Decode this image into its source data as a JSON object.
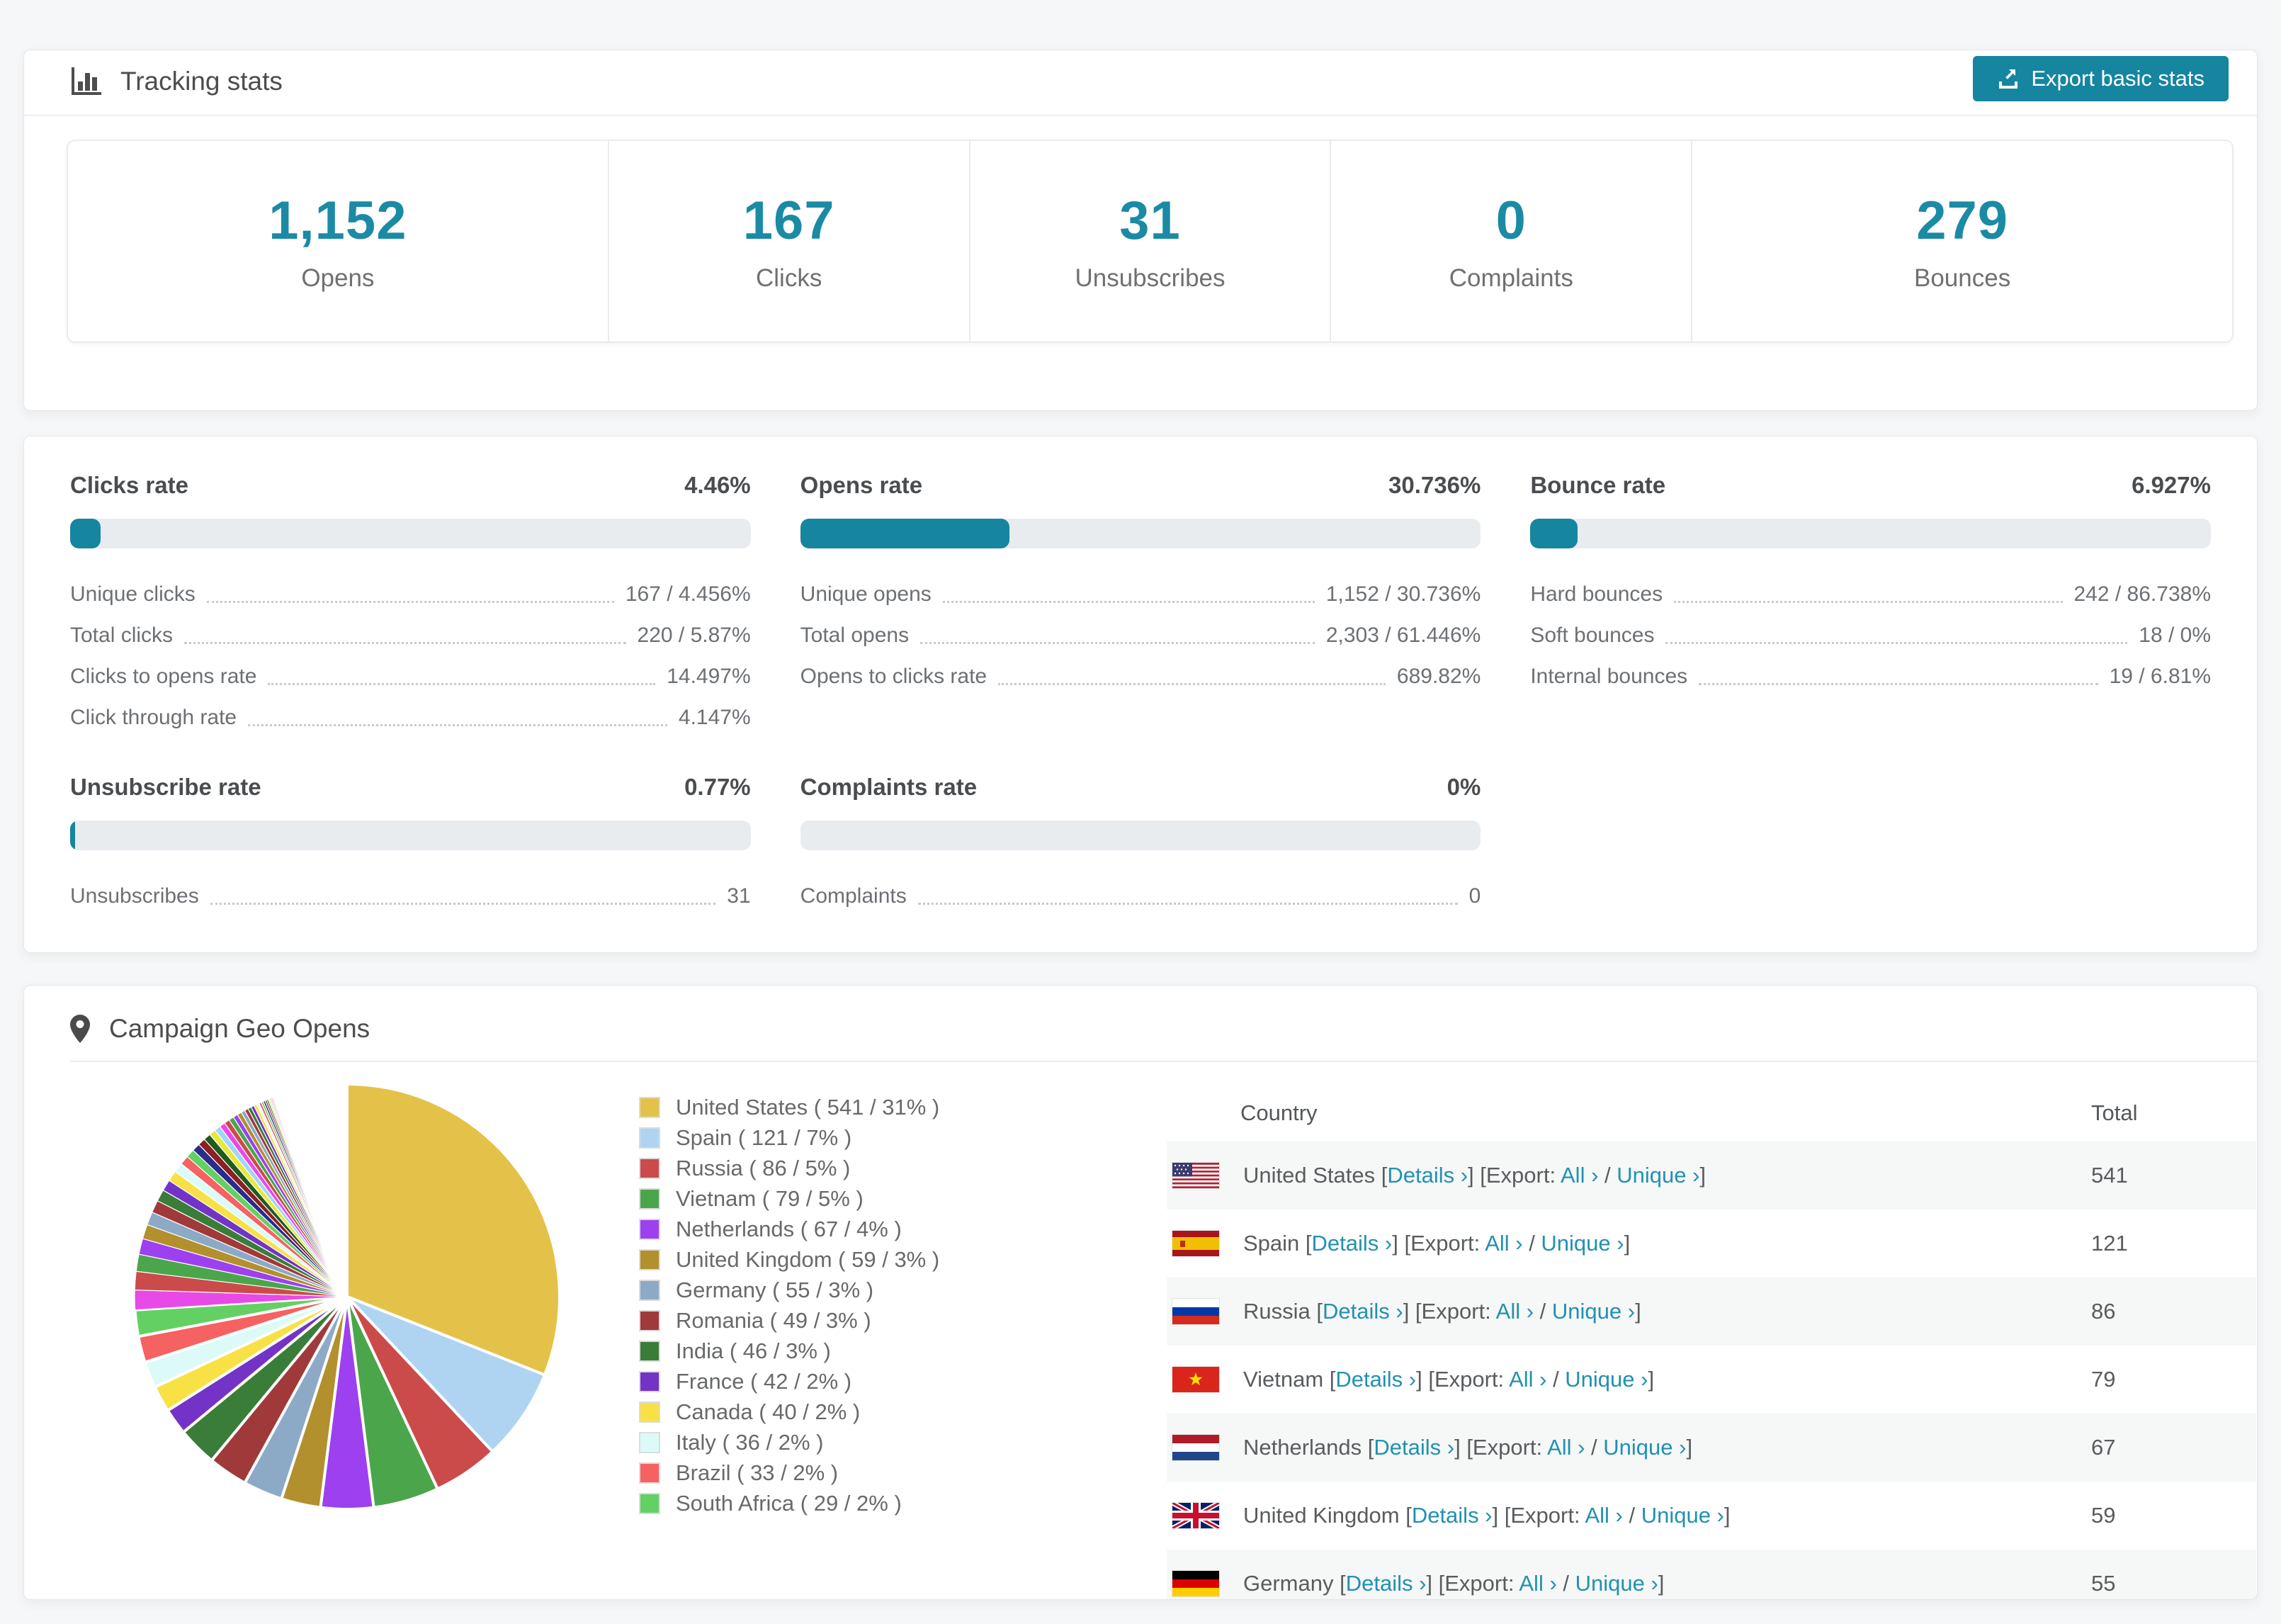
{
  "accent": "#1585a0",
  "tracking": {
    "title": "Tracking stats",
    "export_button": "Export basic stats",
    "stats": [
      {
        "value": "1,152",
        "label": "Opens"
      },
      {
        "value": "167",
        "label": "Clicks"
      },
      {
        "value": "31",
        "label": "Unsubscribes"
      },
      {
        "value": "0",
        "label": "Complaints"
      },
      {
        "value": "279",
        "label": "Bounces"
      }
    ]
  },
  "rates": {
    "blocks": [
      {
        "title": "Clicks rate",
        "value": "4.46%",
        "percent": 4.46,
        "rows": [
          {
            "label": "Unique clicks",
            "value": "167 / 4.456%"
          },
          {
            "label": "Total clicks",
            "value": "220 / 5.87%"
          },
          {
            "label": "Clicks to opens rate",
            "value": "14.497%"
          },
          {
            "label": "Click through rate",
            "value": "4.147%"
          }
        ]
      },
      {
        "title": "Opens rate",
        "value": "30.736%",
        "percent": 30.736,
        "rows": [
          {
            "label": "Unique opens",
            "value": "1,152 / 30.736%"
          },
          {
            "label": "Total opens",
            "value": "2,303 / 61.446%"
          },
          {
            "label": "Opens to clicks rate",
            "value": "689.82%"
          }
        ]
      },
      {
        "title": "Bounce rate",
        "value": "6.927%",
        "percent": 6.927,
        "rows": [
          {
            "label": "Hard bounces",
            "value": "242 / 86.738%"
          },
          {
            "label": "Soft bounces",
            "value": "18 / 0%"
          },
          {
            "label": "Internal bounces",
            "value": "19 / 6.81%"
          }
        ]
      },
      {
        "title": "Unsubscribe rate",
        "value": "0.77%",
        "percent": 0.77,
        "rows": [
          {
            "label": "Unsubscribes",
            "value": "31"
          }
        ]
      },
      {
        "title": "Complaints rate",
        "value": "0%",
        "percent": 0,
        "rows": [
          {
            "label": "Complaints",
            "value": "0"
          }
        ]
      }
    ]
  },
  "geo": {
    "title": "Campaign Geo Opens",
    "table": {
      "columns": {
        "country": "Country",
        "total": "Total"
      },
      "links": {
        "open": " [",
        "details": "Details ›",
        "mid": "] [Export: ",
        "all": "All ›",
        "sep": " / ",
        "unique": "Unique ›",
        "close": "]"
      },
      "rows": [
        {
          "country": "United States",
          "flag": "us",
          "total": "541"
        },
        {
          "country": "Spain",
          "flag": "es",
          "total": "121"
        },
        {
          "country": "Russia",
          "flag": "ru",
          "total": "86"
        },
        {
          "country": "Vietnam",
          "flag": "vn",
          "total": "79"
        },
        {
          "country": "Netherlands",
          "flag": "nl",
          "total": "67"
        },
        {
          "country": "United Kingdom",
          "flag": "gb",
          "total": "59"
        },
        {
          "country": "Germany",
          "flag": "de",
          "total": "55"
        }
      ]
    }
  },
  "chart_data": {
    "type": "pie",
    "title": "Campaign Geo Opens",
    "legend_position": "right",
    "start_angle_deg": -90,
    "direction": "clockwise",
    "slices": [
      {
        "label": "United States",
        "value": 541,
        "percent": 31,
        "color": "#e4c24a",
        "legend": "United States ( 541 / 31% )"
      },
      {
        "label": "Spain",
        "value": 121,
        "percent": 7,
        "color": "#aed4f2",
        "legend": "Spain ( 121 / 7% )"
      },
      {
        "label": "Russia",
        "value": 86,
        "percent": 5,
        "color": "#cb4b4b",
        "legend": "Russia ( 86 / 5% )"
      },
      {
        "label": "Vietnam",
        "value": 79,
        "percent": 5,
        "color": "#4ba64b",
        "legend": "Vietnam ( 79 / 5% )"
      },
      {
        "label": "Netherlands",
        "value": 67,
        "percent": 4,
        "color": "#9c40f0",
        "legend": "Netherlands ( 67 / 4% )"
      },
      {
        "label": "United Kingdom",
        "value": 59,
        "percent": 3,
        "color": "#b2902d",
        "legend": "United Kingdom ( 59 / 3% )"
      },
      {
        "label": "Germany",
        "value": 55,
        "percent": 3,
        "color": "#8caac6",
        "legend": "Germany ( 55 / 3% )"
      },
      {
        "label": "Romania",
        "value": 49,
        "percent": 3,
        "color": "#a03a3a",
        "legend": "Romania ( 49 / 3% )"
      },
      {
        "label": "India",
        "value": 46,
        "percent": 3,
        "color": "#397d39",
        "legend": "India ( 46 / 3% )"
      },
      {
        "label": "France",
        "value": 42,
        "percent": 2,
        "color": "#7433c7",
        "legend": "France ( 42 / 2% )"
      },
      {
        "label": "Canada",
        "value": 40,
        "percent": 2,
        "color": "#f8e144",
        "legend": "Canada ( 40 / 2% )"
      },
      {
        "label": "Italy",
        "value": 36,
        "percent": 2,
        "color": "#dcfbf8",
        "legend": "Italy ( 36 / 2% )"
      },
      {
        "label": "Brazil",
        "value": 33,
        "percent": 2,
        "color": "#f66161",
        "legend": "Brazil ( 33 / 2% )"
      },
      {
        "label": "South Africa",
        "value": 29,
        "percent": 2,
        "color": "#63d063",
        "legend": "South Africa ( 29 / 2% )"
      }
    ],
    "others": {
      "percents": [
        1.5,
        1.4,
        1.3,
        1.2,
        1.1,
        1.0,
        0.95,
        0.9,
        0.85,
        0.8,
        0.75,
        0.7,
        0.65,
        0.6,
        0.57,
        0.54,
        0.5,
        0.47,
        0.44,
        0.41,
        0.38,
        0.36,
        0.33,
        0.3,
        0.28,
        0.26,
        0.24,
        0.22,
        0.2,
        0.18,
        0.16,
        0.15,
        0.13,
        0.12,
        0.11,
        0.1,
        0.09,
        0.08,
        0.07,
        0.06,
        0.05,
        0.05,
        0.04,
        0.04,
        0.03
      ],
      "colors": [
        "#e84ae8",
        "#cb4b4b",
        "#4ba64b",
        "#9c40f0",
        "#b2902d",
        "#8caac6",
        "#a03a3a",
        "#397d39",
        "#7433c7",
        "#f8e144",
        "#dcfbf8",
        "#f66161",
        "#63d063",
        "#2b2b8c",
        "#8c1f1f",
        "#1f5c1f",
        "#e8e83c",
        "#9fd6f9"
      ]
    }
  }
}
